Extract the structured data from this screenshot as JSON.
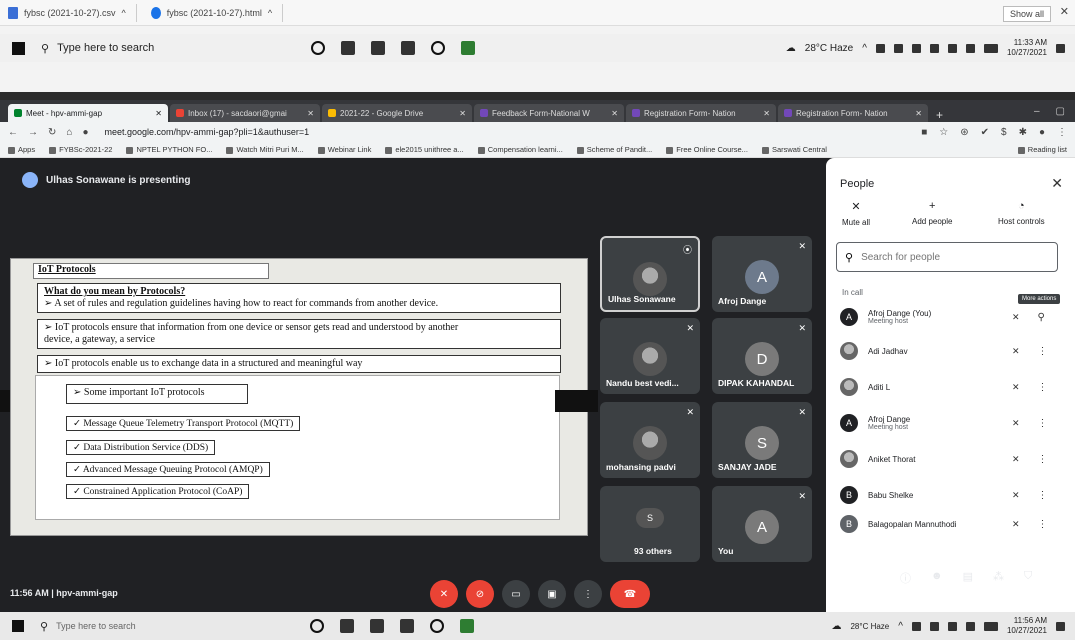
{
  "downloads": {
    "items": [
      "fybsc (2021-10-27).csv",
      "fybsc (2021-10-27).html"
    ],
    "show_all": "Show all"
  },
  "taskbar": {
    "search_placeholder": "Type here to search",
    "weather": "28°C Haze",
    "time_top": "11:33 AM",
    "date_top": "10/27/2021",
    "time_bottom": "11:56 AM",
    "date_bottom": "10/27/2021"
  },
  "chrome": {
    "tabs": [
      {
        "label": "Meet - hpv-ammi-gap",
        "active": true
      },
      {
        "label": "Inbox (17) - sacdaori@gmai",
        "active": false
      },
      {
        "label": "2021-22 - Google Drive",
        "active": false
      },
      {
        "label": "Feedback Form-National W",
        "active": false
      },
      {
        "label": "Registration Form- Nation",
        "active": false
      },
      {
        "label": "Registration Form- Nation",
        "active": false
      }
    ],
    "url": "meet.google.com/hpv-ammi-gap?pli=1&authuser=1",
    "bookmarks": [
      "Apps",
      "FYBSc-2021-22",
      "NPTEL PYTHON FO...",
      "Watch Mitri Puri M...",
      "Webinar Link",
      "ele2015 unithree a...",
      "Compensation learni...",
      "Scheme of Pandit...",
      "Free Online Course...",
      "Sarswati Central"
    ],
    "reading_list": "Reading list"
  },
  "meet": {
    "presenting": "Ulhas Sonawane is presenting",
    "footer_time": "11:56 AM",
    "meeting_code": "hpv-ammi-gap",
    "tiles": [
      {
        "name": "Ulhas Sonawane",
        "initial": "",
        "photo": true
      },
      {
        "name": "Afroj Dange",
        "initial": "A",
        "photo": false
      },
      {
        "name": "Nandu best vedi...",
        "initial": "",
        "photo": true
      },
      {
        "name": "DIPAK KAHANDAL",
        "initial": "D",
        "photo": false
      },
      {
        "name": "mohansing padvi",
        "initial": "",
        "photo": true
      },
      {
        "name": "SANJAY JADE",
        "initial": "S",
        "photo": false
      },
      {
        "name": "93 others",
        "initial": "S",
        "photo": false
      },
      {
        "name": "You",
        "initial": "A",
        "photo": false
      }
    ]
  },
  "slide": {
    "title": "IoT Protocols",
    "question": "What do you mean by Protocols?",
    "line1": "A set of rules and regulation guidelines having how to react for commands from another device.",
    "line2a": "IoT protocols ensure that information from one device or sensor gets read and understood by another",
    "line2b": "device, a gateway, a service",
    "line3": "IoT protocols enable us to exchange data in a structured and meaningful way",
    "heading": "Some important IoT protocols",
    "protocols": [
      "Message Queue Telemetry Transport Protocol (MQTT)",
      "Data Distribution Service (DDS)",
      "Advanced Message Queuing Protocol (AMQP)",
      "Constrained Application Protocol (CoAP)"
    ]
  },
  "people": {
    "title": "People",
    "mute_all": "Mute all",
    "add_people": "Add people",
    "host_controls": "Host controls",
    "search_placeholder": "Search for people",
    "in_call": "In call",
    "tooltip": "More actions",
    "list": [
      {
        "name": "Afroj Dange (You)",
        "role": "Meeting host",
        "initial": "A"
      },
      {
        "name": "Adi Jadhav",
        "role": "",
        "initial": ""
      },
      {
        "name": "Aditi L",
        "role": "",
        "initial": ""
      },
      {
        "name": "Afroj Dange",
        "role": "Meeting host",
        "initial": "A"
      },
      {
        "name": "Aniket Thorat",
        "role": "",
        "initial": ""
      },
      {
        "name": "Babu Shelke",
        "role": "",
        "initial": "B"
      },
      {
        "name": "Balagopalan Mannuthodi",
        "role": "",
        "initial": "B"
      }
    ]
  }
}
